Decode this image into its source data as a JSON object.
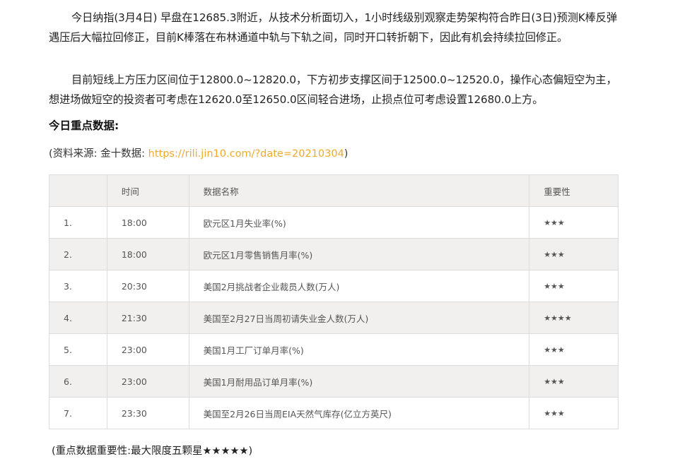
{
  "article": {
    "paragraph1": "今日纳指(3月4日) 早盘在12685.3附近，从技术分析面切入，1小时线级别观察走势架构符合昨日(3日)预测K棒反弹遇压后大幅拉回修正，目前K棒落在布林通道中轨与下轨之间，同时开口转折朝下，因此有机会持续拉回修正。",
    "paragraph2": "目前短线上方压力区间位于12800.0~12820.0，下方初步支撑区间于12500.0~12520.0，操作心态偏短空为主，想进场做短空的投资者可考虑在12620.0至12650.0区间轻合进场，止损点位可考虑设置12680.0上方。",
    "heading": "今日重点数据:",
    "source_prefix": "(资料来源: 金十数据: ",
    "source_link": "https://rili.jin10.com/?date=20210304",
    "source_suffix": ")",
    "note": "(重点数据重要性:最大限度五颗星★★★★★)"
  },
  "table": {
    "headers": [
      "",
      "时间",
      "数据名称",
      "重要性"
    ],
    "rows": [
      {
        "idx": "1.",
        "time": "18:00",
        "name": "欧元区1月失业率(%)",
        "importance": "★★★"
      },
      {
        "idx": "2.",
        "time": "18:00",
        "name": "欧元区1月零售销售月率(%)",
        "importance": "★★★"
      },
      {
        "idx": "3.",
        "time": "20:30",
        "name": "美国2月挑战者企业裁员人数(万人)",
        "importance": "★★★"
      },
      {
        "idx": "4.",
        "time": "21:30",
        "name": "美国至2月27日当周初请失业金人数(万人)",
        "importance": "★★★★"
      },
      {
        "idx": "5.",
        "time": "23:00",
        "name": "美国1月工厂订单月率(%)",
        "importance": "★★★"
      },
      {
        "idx": "6.",
        "time": "23:00",
        "name": "美国1月耐用品订单月率(%)",
        "importance": "★★★"
      },
      {
        "idx": "7.",
        "time": "23:30",
        "name": "美国至2月26日当周EIA天然气库存(亿立方英尺)",
        "importance": "★★★"
      }
    ]
  },
  "colors": {
    "link": "#f0a92a",
    "row_shade": "#f1f0ee",
    "border": "#dcdcdc"
  }
}
